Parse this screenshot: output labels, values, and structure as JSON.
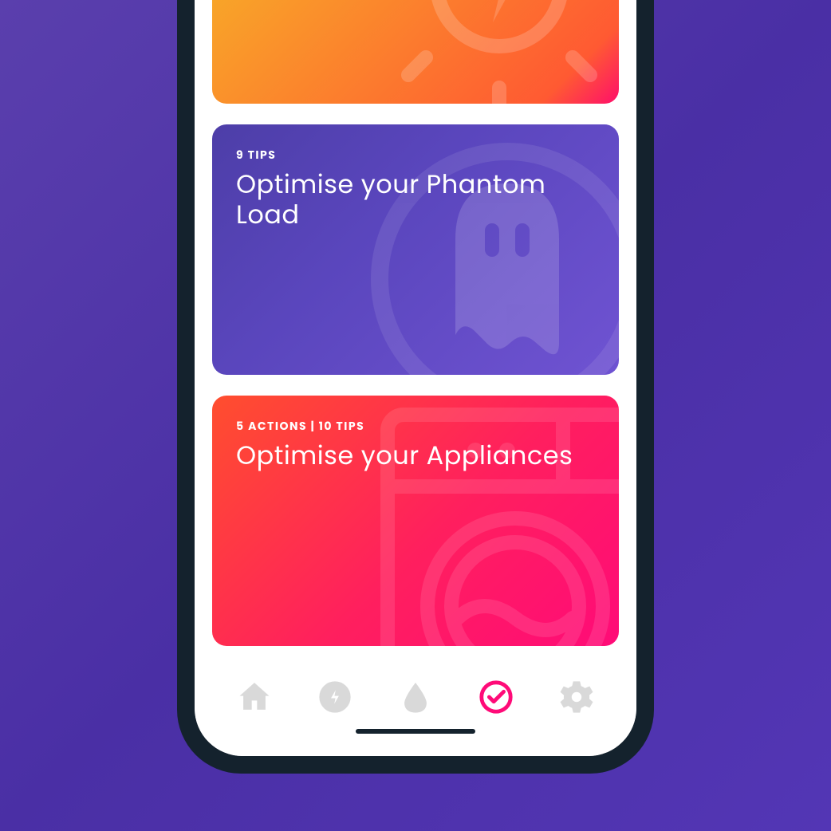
{
  "cards": [
    {
      "meta": "",
      "title": ""
    },
    {
      "meta": "9 TIPS",
      "title": "Optimise your Phantom Load"
    },
    {
      "meta": "5 ACTIONS | 10 TIPS",
      "title": "Optimise your Appliances"
    }
  ],
  "nav": {
    "items": [
      "home",
      "energy",
      "water",
      "tips",
      "settings"
    ],
    "active_index": 3
  },
  "colors": {
    "accent": "#ff0b78",
    "background_start": "#5a3fad",
    "background_end": "#5336b5"
  }
}
